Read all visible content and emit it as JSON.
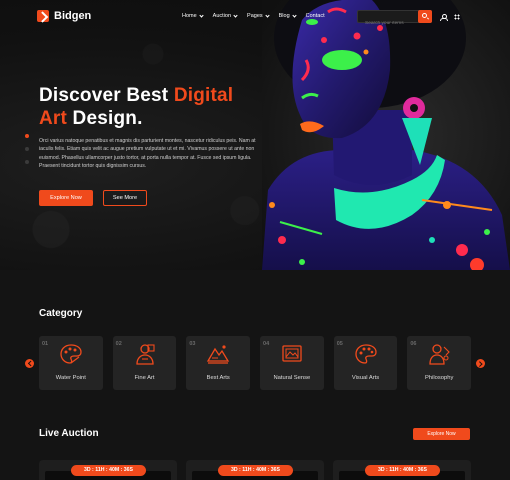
{
  "header": {
    "logo": "Bidgen",
    "nav": [
      {
        "label": "Home",
        "dropdown": true
      },
      {
        "label": "Auction",
        "dropdown": true
      },
      {
        "label": "Pages",
        "dropdown": true
      },
      {
        "label": "Blog",
        "dropdown": true
      },
      {
        "label": "Contact",
        "dropdown": false
      }
    ],
    "search_placeholder": "Search your items",
    "icons": [
      "search-icon",
      "user-icon",
      "grid-icon"
    ]
  },
  "hero": {
    "title_part1": "Discover Best ",
    "title_accent1": "Digital",
    "title_accent2": "Art",
    "title_part2": " Design.",
    "description": "Orci varius natoque penatibus et magnis dis parturient montes, nascetur ridiculus peis. Nam at iaculis felis. Etiam quis velit ac augue pretium vulputate ut et mi. Vivamus possere ut ante non euismod. Phasellus ullamcorper justo tortor, at porta nulla tempor at. Fusce sed ipsum ligula. Praesent tincidunt tortor quis dignissim cursus.",
    "primary_button": "Explore Now",
    "secondary_button": "See More",
    "slides": 3,
    "active_slide": 1
  },
  "category": {
    "title": "Category",
    "items": [
      {
        "num": "01",
        "label": "Water Point",
        "icon": "palette-icon"
      },
      {
        "num": "02",
        "label": "Fine Art",
        "icon": "artist-icon"
      },
      {
        "num": "03",
        "label": "Best Arts",
        "icon": "mountain-painting-icon"
      },
      {
        "num": "04",
        "label": "Natural Sense",
        "icon": "landscape-frame-icon"
      },
      {
        "num": "05",
        "label": "Visual Arts",
        "icon": "palette-brush-icon"
      },
      {
        "num": "06",
        "label": "Philosophy",
        "icon": "painter-icon"
      }
    ]
  },
  "auction": {
    "title": "Live Auction",
    "button": "Explore Now",
    "timers": [
      "3D : 11H : 40M : 36S",
      "3D : 11H : 40M : 36S",
      "3D : 11H : 40M : 36S"
    ]
  },
  "colors": {
    "accent": "#f04a1c",
    "background": "#141414",
    "card": "#242424"
  }
}
